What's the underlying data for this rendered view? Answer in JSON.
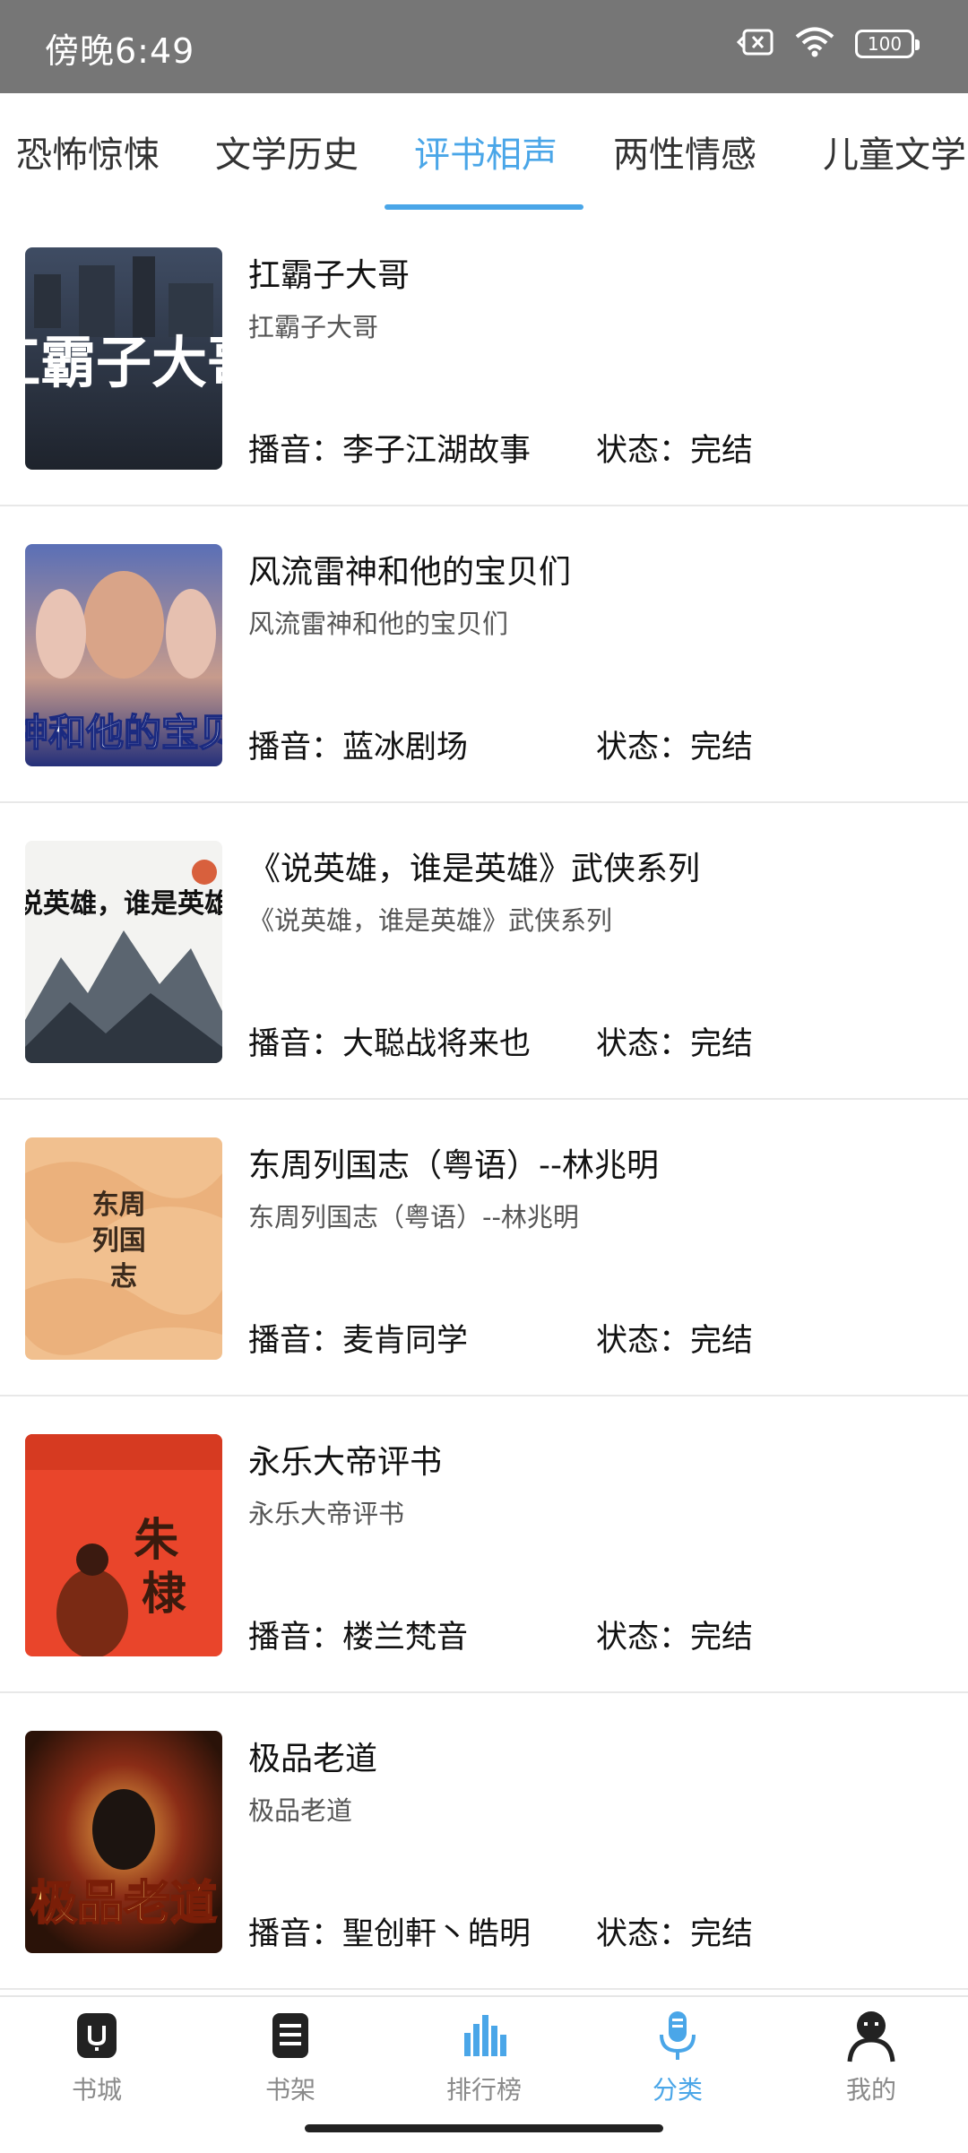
{
  "status_bar": {
    "time": "傍晚6:49",
    "battery": "100",
    "icons": [
      "sim-x-icon",
      "wifi-icon",
      "battery-icon"
    ]
  },
  "tabs": [
    {
      "label": "恐怖惊悚"
    },
    {
      "label": "文学历史"
    },
    {
      "label": "评书相声"
    },
    {
      "label": "两性情感"
    },
    {
      "label": "儿童文学"
    }
  ],
  "active_tab_index": 2,
  "colors": {
    "accent": "#4aa6e8",
    "status_bar": "#767676"
  },
  "books": [
    {
      "title": "扛霸子大哥",
      "subtitle": "扛霸子大哥",
      "narrator": "播音：李子江湖故事",
      "status": "状态：完结",
      "cover_text": "扛霸子大哥"
    },
    {
      "title": "风流雷神和他的宝贝们",
      "subtitle": "风流雷神和他的宝贝们",
      "narrator": "播音：蓝冰剧场",
      "status": "状态：完结",
      "cover_text": "雷神和他的宝贝们"
    },
    {
      "title": "《说英雄，谁是英雄》武侠系列",
      "subtitle": "《说英雄，谁是英雄》武侠系列",
      "narrator": "播音：大聪战将来也",
      "status": "状态：完结",
      "cover_text": "说英雄，谁是英雄"
    },
    {
      "title": "东周列国志（粤语）--林兆明",
      "subtitle": "东周列国志（粤语）--林兆明",
      "narrator": "播音：麦肯同学",
      "status": "状态：完结",
      "cover_text": "东周列国志"
    },
    {
      "title": "永乐大帝评书",
      "subtitle": "永乐大帝评书",
      "narrator": "播音：楼兰梵音",
      "status": "状态：完结",
      "cover_text": "朱棣"
    },
    {
      "title": "极品老道",
      "subtitle": "极品老道",
      "narrator": "播音：聖创軒丶皓明",
      "status": "状态：完结",
      "cover_text": "极品老道"
    }
  ],
  "bottom_nav": [
    {
      "label": "书城",
      "icon": "bookstore-icon"
    },
    {
      "label": "书架",
      "icon": "bookshelf-icon"
    },
    {
      "label": "排行榜",
      "icon": "ranking-icon"
    },
    {
      "label": "分类",
      "icon": "microphone-icon"
    },
    {
      "label": "我的",
      "icon": "profile-icon"
    }
  ],
  "active_nav_index": 3
}
